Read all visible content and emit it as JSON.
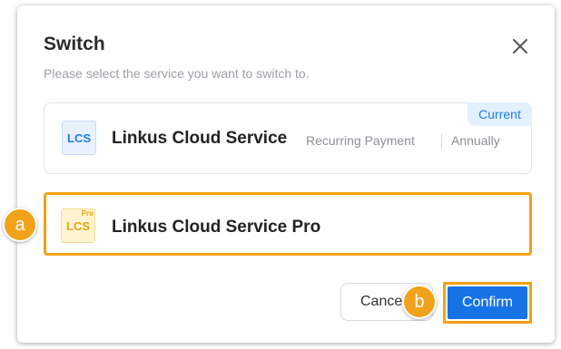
{
  "dialog": {
    "title": "Switch",
    "subtitle": "Please select the service you want to switch to."
  },
  "services": [
    {
      "logo_text": "LCS",
      "name": "Linkus Cloud Service",
      "billing": "Recurring Payment",
      "cycle": "Annually",
      "badge": "Current"
    },
    {
      "logo_text": "LCS",
      "logo_tag": "Pro",
      "name": "Linkus Cloud Service Pro",
      "selected": true
    }
  ],
  "buttons": {
    "cancel_label": "Cance",
    "confirm_label": "Confirm"
  },
  "callouts": [
    "a",
    "b"
  ],
  "colors": {
    "accent": "#1673e6",
    "highlight": "#f5a00f",
    "current_badge_bg": "#e3f0fd",
    "pro_logo": "#e3a417"
  },
  "icons": {
    "close": "close-icon"
  }
}
